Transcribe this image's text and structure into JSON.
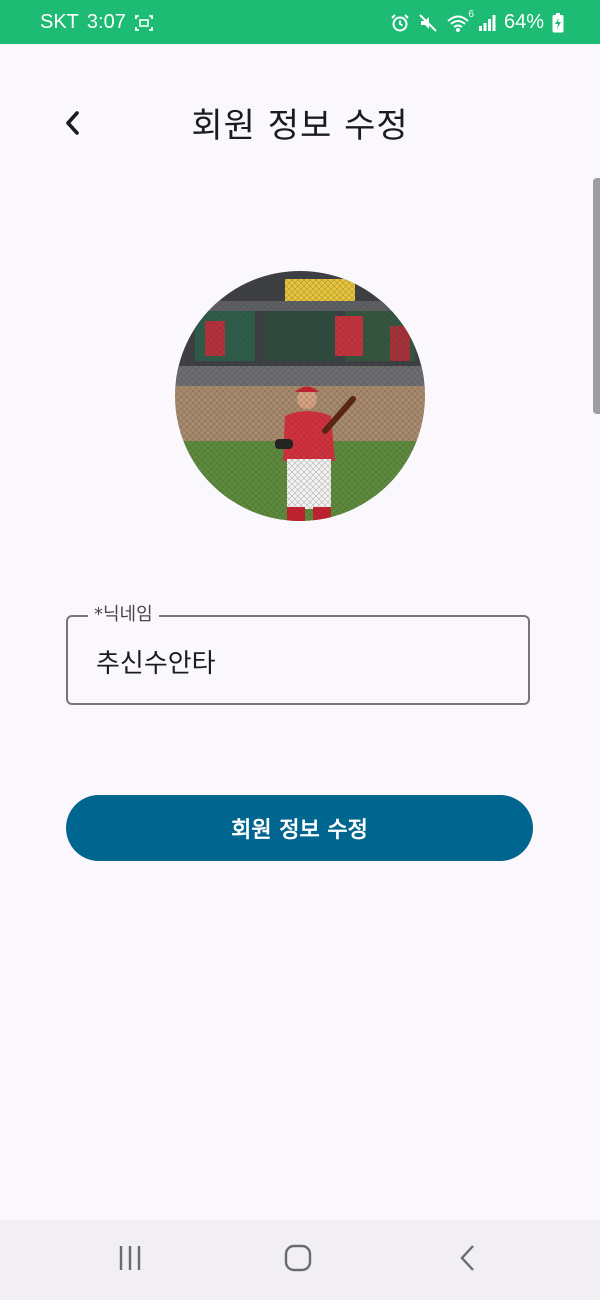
{
  "status_bar": {
    "carrier": "SKT",
    "time": "3:07",
    "wifi_badge": "6",
    "battery": "64%",
    "background_color": "#1dbb74"
  },
  "header": {
    "back_icon": "chevron-left-icon",
    "title": "회원 정보 수정"
  },
  "profile": {
    "image": "baseball-player-batting-photo"
  },
  "form": {
    "nickname_label": "*닉네임",
    "nickname_value": "추신수안타"
  },
  "submit": {
    "label": "회원 정보 수정",
    "color": "#00658f"
  },
  "nav_bar": {
    "recents_icon": "recents-icon",
    "home_icon": "home-icon",
    "back_icon": "nav-back-icon"
  }
}
